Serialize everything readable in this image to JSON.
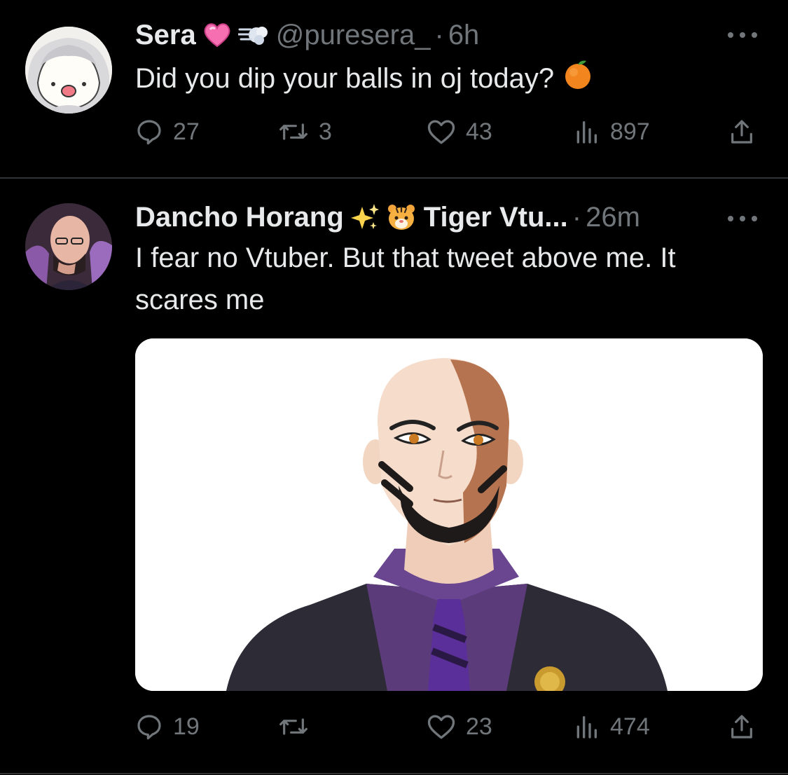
{
  "tweets": [
    {
      "name": "Sera",
      "handle": "@puresera_",
      "separator": "·",
      "time": "6h",
      "text": "Did you dip your balls in oj today?",
      "counts": {
        "replies": "27",
        "retweets": "3",
        "likes": "43",
        "views": "897"
      }
    },
    {
      "name": "Dancho Horang",
      "name_suffix": "Tiger Vtu...",
      "separator": "·",
      "time": "26m",
      "text": "I fear no Vtuber. But that tweet above me. It scares me",
      "counts": {
        "replies": "19",
        "retweets": "",
        "likes": "23",
        "views": "474"
      }
    }
  ],
  "icons": {
    "name_emoji_1": "pink-heart-icon",
    "name_emoji_2": "dash-wind-icon",
    "text_emoji": "orange-fruit-icon",
    "name_emoji_3": "sparkles-icon",
    "name_emoji_4": "tiger-face-icon",
    "actions": [
      "reply-icon",
      "retweet-icon",
      "like-icon",
      "views-icon",
      "share-icon"
    ],
    "more": "more-options-icon"
  },
  "colors": {
    "background": "#000000",
    "text": "#e7e9ea",
    "muted": "#71767b",
    "divider": "#2f3336"
  }
}
